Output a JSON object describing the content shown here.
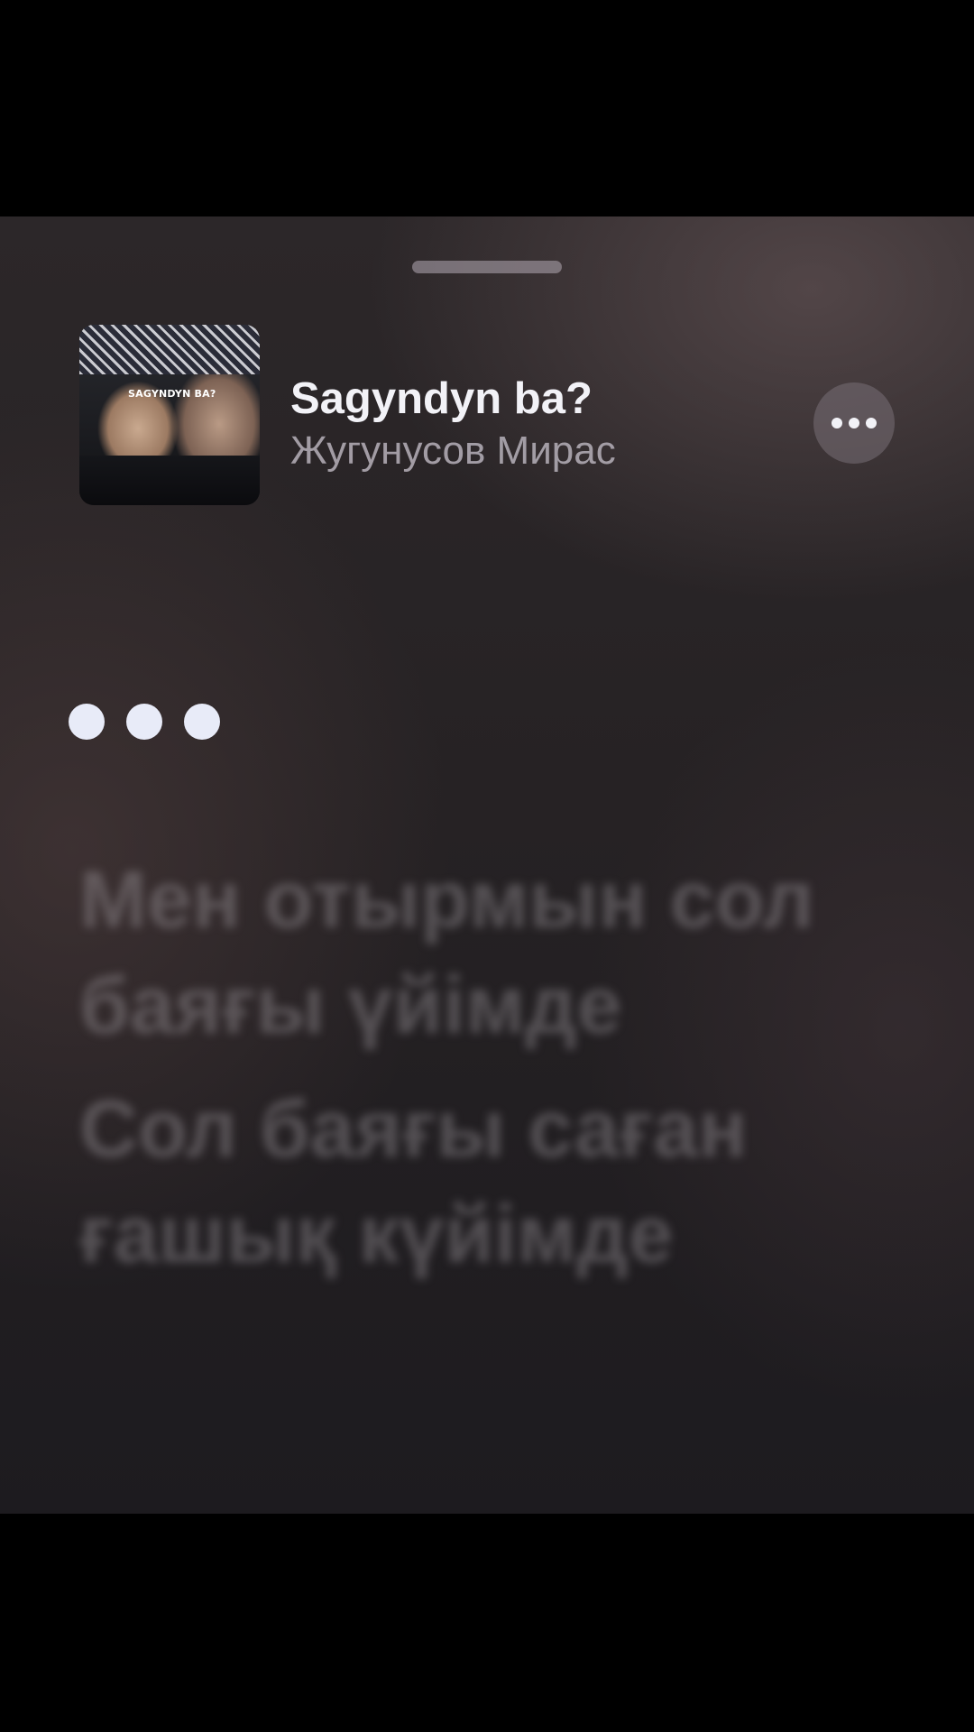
{
  "track": {
    "title": "Sagyndyn ba?",
    "artist": "Жугунусов Мирас",
    "artwork": {
      "title": "SAGYNDYN BA?",
      "subtitle": "",
      "icon": "album-artwork"
    }
  },
  "controls": {
    "more_icon": "ellipsis-icon",
    "grabber_icon": "sheet-grabber"
  },
  "lyrics": {
    "interlude_indicator": "ellipsis-dots",
    "lines": [
      "Мен отырмын сол баяғы үйімде",
      "Сол баяғы саған ғашық күйімде"
    ]
  },
  "colors": {
    "background": "#262224",
    "title": "#f2f2f7",
    "artist": "#afaab2",
    "accent_dots": "#e8ebf8"
  }
}
